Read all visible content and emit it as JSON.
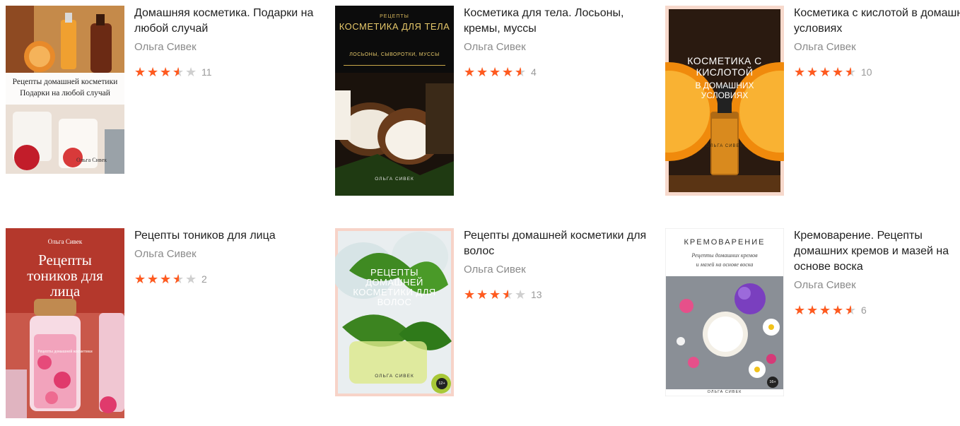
{
  "books": [
    {
      "title": "Домашняя косметика. Подарки на любой случай",
      "author": "Ольга Сивек",
      "rating": 3.5,
      "reviews": "11",
      "cover": {
        "lines": [
          "Рецепты домашней косметики",
          "Подарки на любой случай"
        ],
        "author": "Ольга Сивек"
      }
    },
    {
      "title": "Косметика для тела. Лосьоны, кремы, муссы",
      "author": "Ольга Сивек",
      "rating": 4.5,
      "reviews": "4",
      "cover": {
        "top": "РЕЦЕПТЫ",
        "title": "КОСМЕТИКА ДЛЯ ТЕЛА",
        "subtitle": "ЛОСЬОНЫ, СЫВОРОТКИ, МУССЫ",
        "author": "ОЛЬГА СИВЕК"
      }
    },
    {
      "title": "Косметика с кислотой в домашних условиях",
      "author": "Ольга Сивек",
      "rating": 4.5,
      "reviews": "10",
      "cover": {
        "title1": "КОСМЕТИКА С",
        "title2": "КИСЛОТОЙ",
        "title3": "В ДОМАШНИХ",
        "title4": "УСЛОВИЯХ",
        "author": "ОЛЬГА СИВЕК"
      }
    },
    {
      "title": "Рецепты тоников для лица",
      "author": "Ольга Сивек",
      "rating": 3.5,
      "reviews": "2",
      "cover": {
        "author": "Ольга Сивек",
        "title1": "Рецепты",
        "title2": "тоников для",
        "title3": "лица",
        "subtitle": "Рецепты домашней косметики"
      }
    },
    {
      "title": "Рецепты домашней косметики для волос",
      "author": "Ольга Сивек",
      "rating": 3.5,
      "reviews": "13",
      "cover": {
        "title1": "РЕЦЕПТЫ",
        "title2": "ДОМАШНЕЙ",
        "title3": "КОСМЕТИКИ ДЛЯ",
        "title4": "ВОЛОС",
        "author": "ОЛЬГА СИВЕК",
        "age": "12+"
      }
    },
    {
      "title": "Кремоварение. Рецепты домашних кремов и мазей на основе воска",
      "author": "Ольга Сивек",
      "rating": 4.5,
      "reviews": "6",
      "cover": {
        "title": "КРЕМОВАРЕНИЕ",
        "sub1": "Рецепты домашних кремов",
        "sub2": "и мазей на основе воска",
        "author": "ОЛЬГА СИВЕК",
        "age": "16+"
      }
    }
  ]
}
